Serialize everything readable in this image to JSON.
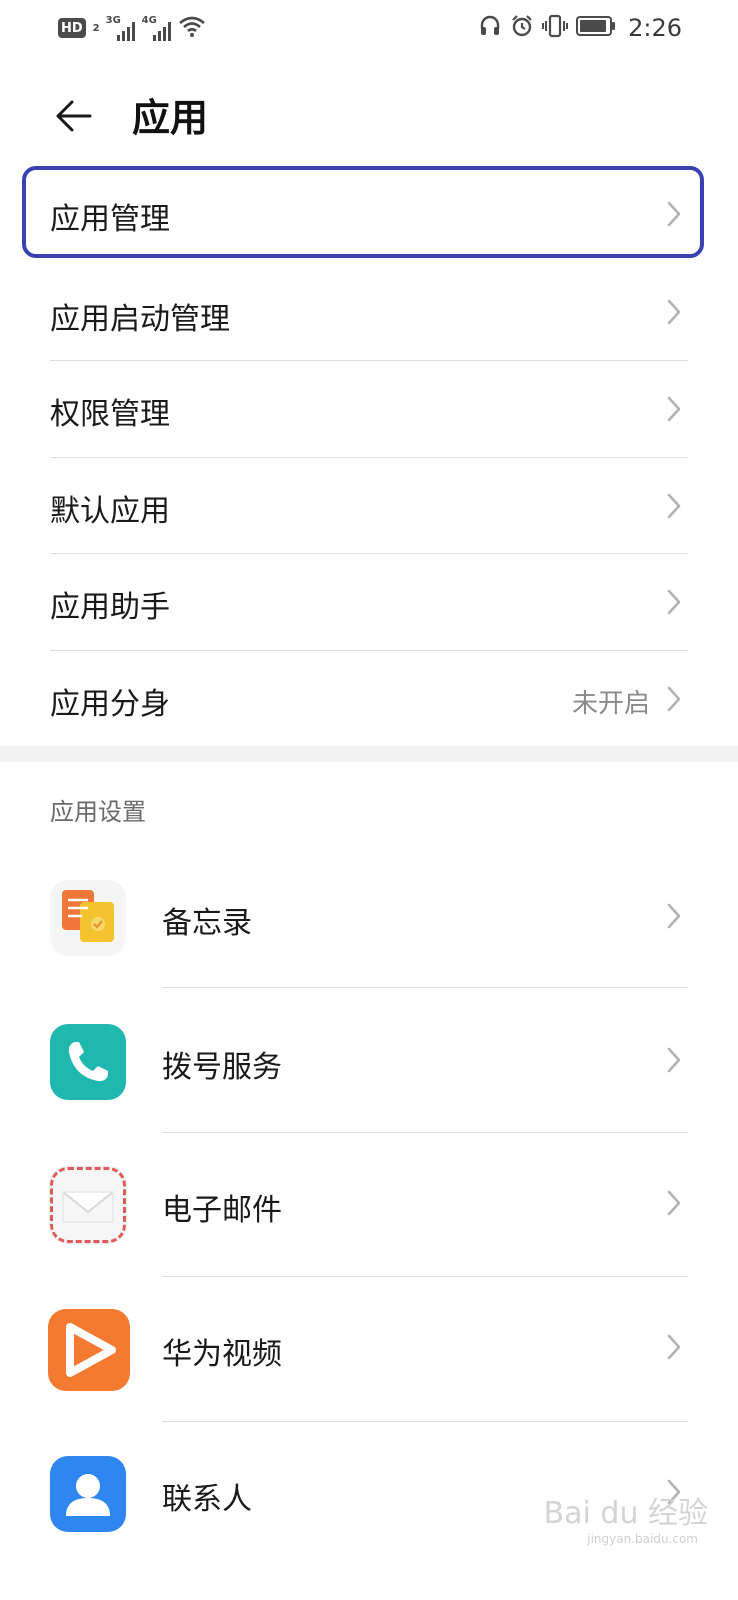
{
  "status_bar": {
    "hd_badge": "HD",
    "hd_sub": "2",
    "sim1_tech": "3G",
    "sim2_tech": "4G",
    "time": "2:26",
    "icons": [
      "hd-icon",
      "signal-icon",
      "signal-icon",
      "wifi-icon",
      "headphones-icon",
      "alarm-icon",
      "vibrate-icon",
      "battery-icon"
    ]
  },
  "header": {
    "title": "应用",
    "back_icon": "back-arrow-icon"
  },
  "menu": {
    "items": [
      {
        "label": "应用管理"
      },
      {
        "label": "应用启动管理"
      },
      {
        "label": "权限管理"
      },
      {
        "label": "默认应用"
      },
      {
        "label": "应用助手"
      },
      {
        "label": "应用分身",
        "value": "未开启"
      }
    ]
  },
  "app_settings": {
    "title": "应用设置",
    "apps": [
      {
        "label": "备忘录",
        "icon": "notepad-icon"
      },
      {
        "label": "拨号服务",
        "icon": "phone-icon"
      },
      {
        "label": "电子邮件",
        "icon": "email-icon"
      },
      {
        "label": "华为视频",
        "icon": "video-icon"
      },
      {
        "label": "联系人",
        "icon": "contacts-icon"
      }
    ]
  },
  "colors": {
    "highlight": "#3942b4",
    "chevron": "#b3b3b3",
    "value_text": "#8a8a8a"
  },
  "watermark": {
    "text": "Bai du 经验",
    "sub": "jingyan.baidu.com"
  }
}
